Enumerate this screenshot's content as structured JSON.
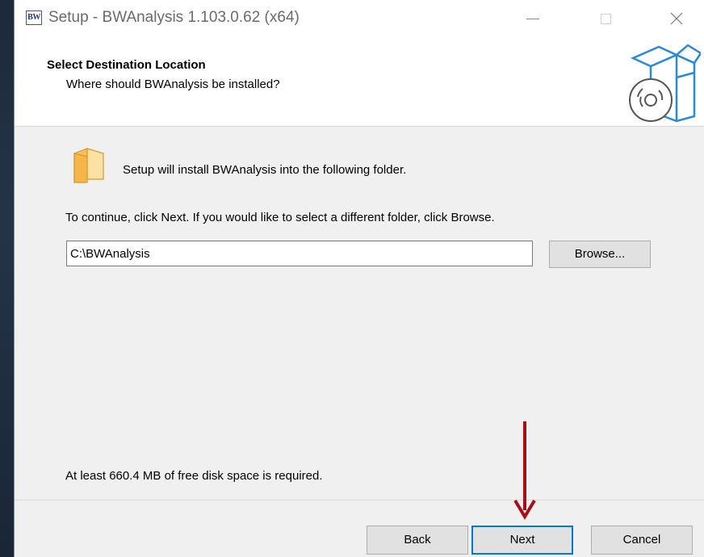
{
  "window": {
    "icon_text": "BW",
    "title": "Setup - BWAnalysis 1.103.0.62 (x64)"
  },
  "header": {
    "title": "Select Destination Location",
    "subtitle": "Where should BWAnalysis be installed?"
  },
  "body": {
    "install_message": "Setup will install BWAnalysis into the following folder.",
    "continue_message": "To continue, click Next. If you would like to select a different folder, click Browse.",
    "path_value": "C:\\BWAnalysis",
    "browse_label": "Browse...",
    "disk_space_message": "At least 660.4 MB of free disk space is required."
  },
  "footer": {
    "back_label": "Back",
    "next_label": "Next",
    "cancel_label": "Cancel"
  },
  "icons": {
    "app": "bw-app-icon",
    "minimize": "minimize-icon",
    "maximize": "maximize-icon",
    "close": "close-icon",
    "header": "setup-box-disc-icon",
    "folder": "folder-icon",
    "annotation": "red-down-arrow"
  },
  "colors": {
    "accent": "#0078d7",
    "annotation": "#a50f15",
    "panel": "#f0f0f0"
  }
}
